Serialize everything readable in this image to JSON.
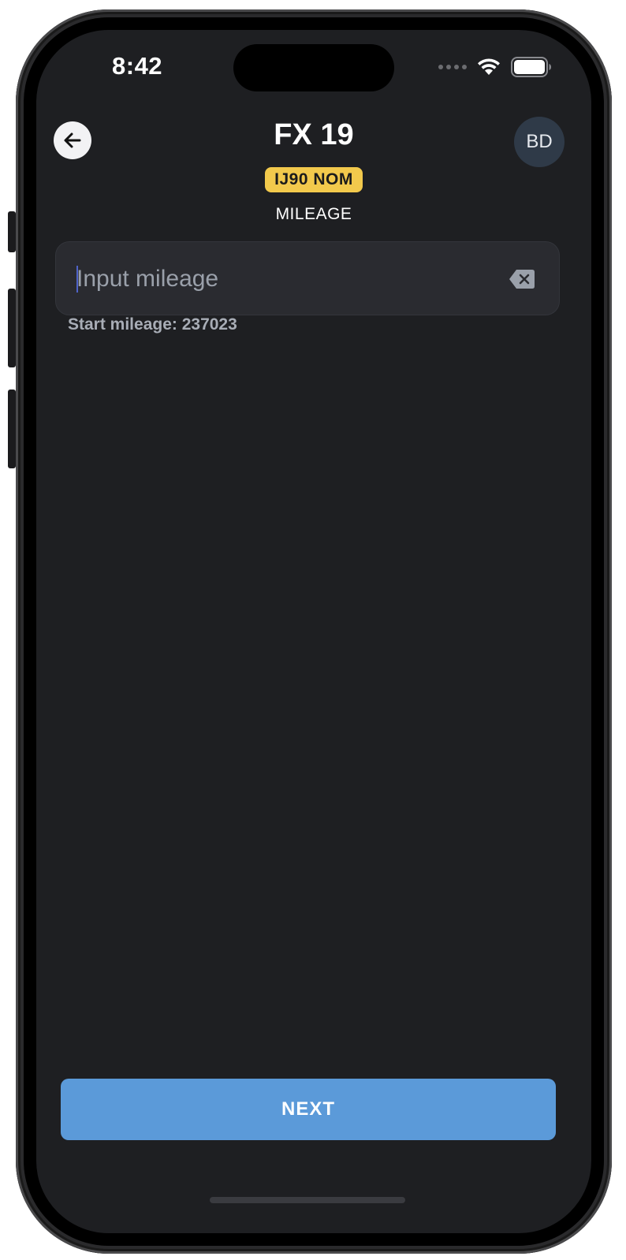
{
  "status_bar": {
    "time": "8:42",
    "wifi_icon": "wifi-icon",
    "battery_icon": "battery-icon"
  },
  "header": {
    "title": "FX 19",
    "plate": "IJ90 NOM",
    "step_label": "MILEAGE",
    "avatar_initials": "BD",
    "back_icon": "arrow-left-icon"
  },
  "mileage_input": {
    "value": "",
    "placeholder": "Input mileage",
    "clear_icon": "backspace-clear-icon"
  },
  "start_mileage_text": "Start mileage: 237023",
  "actions": {
    "next_label": "NEXT"
  },
  "colors": {
    "background": "#1e1f22",
    "plate_yellow": "#f2c94c",
    "next_blue": "#5b9ad9",
    "avatar_bg": "#2f3a48"
  }
}
